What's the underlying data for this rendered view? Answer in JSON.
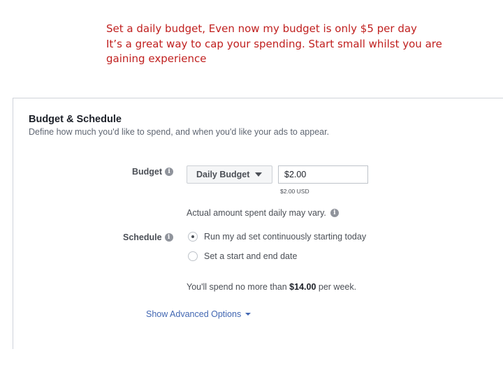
{
  "caption": {
    "line1": "Set a daily budget, Even now my budget is only $5 per day",
    "line2": "It’s a great way to cap your spending. Start small whilst you are",
    "line3": "gaining experience"
  },
  "panel": {
    "title": "Budget & Schedule",
    "subtitle": "Define how much you'd like to spend, and when you'd like your ads to appear."
  },
  "budget": {
    "label": "Budget",
    "info_icon": "info-icon",
    "type_selected": "Daily Budget",
    "amount_value": "$2.00",
    "amount_usd": "$2.00 USD",
    "vary_note": "Actual amount spent daily may vary."
  },
  "schedule": {
    "label": "Schedule",
    "options": [
      {
        "label": "Run my ad set continuously starting today",
        "checked": true
      },
      {
        "label": "Set a start and end date",
        "checked": false
      }
    ]
  },
  "spend": {
    "prefix": "You'll spend no more than ",
    "amount": "$14.00",
    "suffix": " per week."
  },
  "advanced": {
    "label": "Show Advanced Options"
  },
  "colors": {
    "caption": "#c0201f",
    "link": "#4267b2",
    "text": "#4b4f56"
  }
}
